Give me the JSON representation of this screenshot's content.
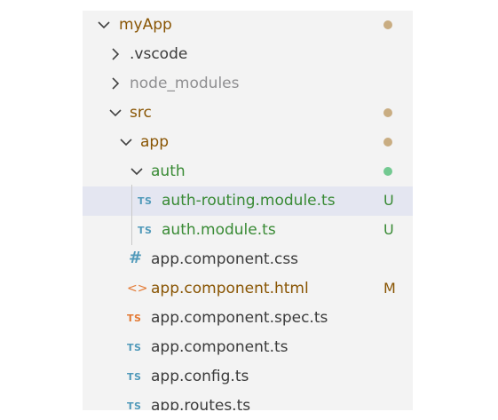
{
  "explorer": {
    "items": [
      {
        "label": "myApp",
        "kind": "folder",
        "expanded": true,
        "status": "modified-dot"
      },
      {
        "label": ".vscode",
        "kind": "folder",
        "expanded": false,
        "status": ""
      },
      {
        "label": "node_modules",
        "kind": "folder",
        "expanded": false,
        "status": "ignored"
      },
      {
        "label": "src",
        "kind": "folder",
        "expanded": true,
        "status": "modified-dot"
      },
      {
        "label": "app",
        "kind": "folder",
        "expanded": true,
        "status": "modified-dot"
      },
      {
        "label": "auth",
        "kind": "folder",
        "expanded": true,
        "status": "untracked-dot"
      },
      {
        "label": "auth-routing.module.ts",
        "kind": "file",
        "icon": "TS",
        "badge": "U",
        "selected": true
      },
      {
        "label": "auth.module.ts",
        "kind": "file",
        "icon": "TS",
        "badge": "U"
      },
      {
        "label": "app.component.css",
        "kind": "file",
        "icon": "#"
      },
      {
        "label": "app.component.html",
        "kind": "file",
        "icon": "<>",
        "badge": "M"
      },
      {
        "label": "app.component.spec.ts",
        "kind": "file",
        "icon": "TS"
      },
      {
        "label": "app.component.ts",
        "kind": "file",
        "icon": "TS"
      },
      {
        "label": "app.config.ts",
        "kind": "file",
        "icon": "TS"
      },
      {
        "label": "app.routes.ts",
        "kind": "file",
        "icon": "TS"
      }
    ]
  },
  "colors": {
    "modified": "#895503",
    "modified_dot": "#c9ad82",
    "untracked": "#388a34",
    "untracked_dot": "#73c991",
    "ignored": "#8e8e90",
    "ts_icon": "#519aba",
    "spec_icon": "#e37933",
    "selection": "#e4e6f1"
  }
}
